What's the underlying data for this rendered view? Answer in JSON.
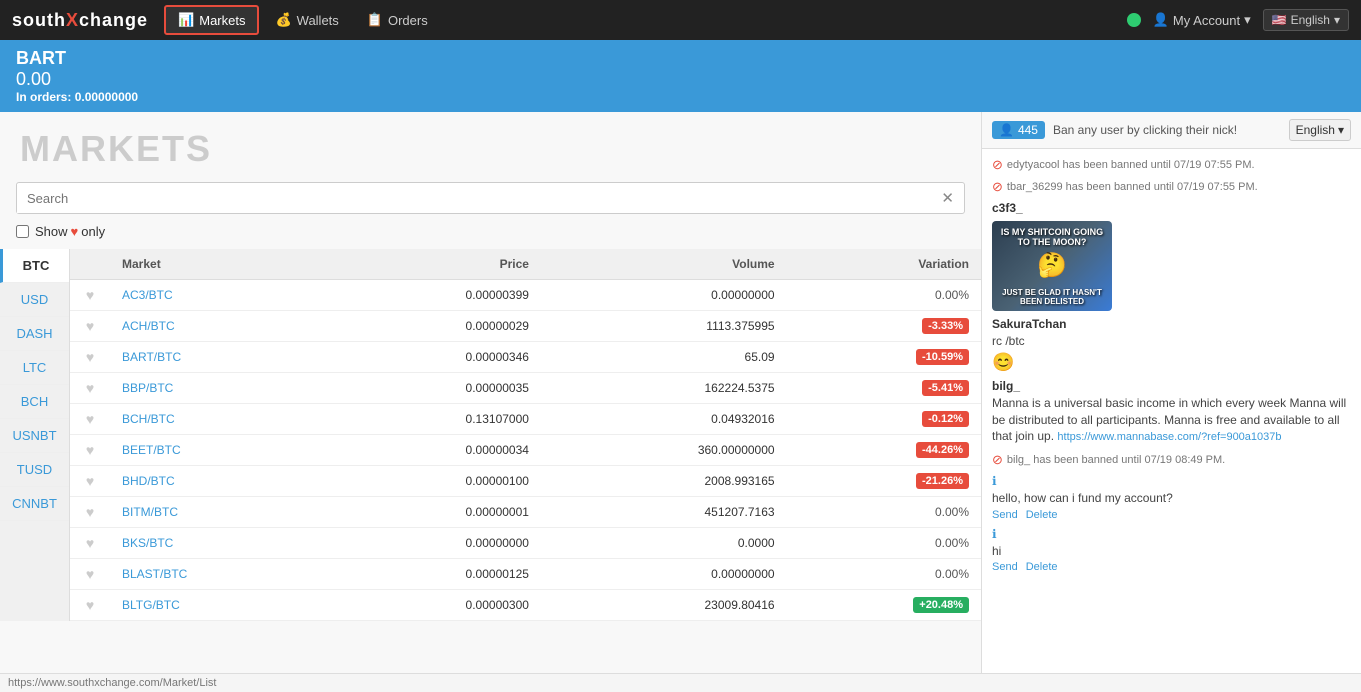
{
  "logo": {
    "text_south": "south",
    "text_x": "X",
    "text_change": "change"
  },
  "nav": {
    "items": [
      {
        "id": "markets",
        "label": "Markets",
        "icon": "chart-bar",
        "active": true
      },
      {
        "id": "wallets",
        "label": "Wallets",
        "icon": "wallet",
        "active": false
      },
      {
        "id": "orders",
        "label": "Orders",
        "icon": "list",
        "active": false
      }
    ],
    "my_account": "My Account",
    "language": "English",
    "language_icon": "🇺🇸"
  },
  "bart_header": {
    "coin": "BART",
    "price": "0.00",
    "in_orders_label": "In orders:",
    "in_orders_value": "0.00000000"
  },
  "markets_page": {
    "title": "MARKETS",
    "search_placeholder": "Search",
    "favorites_label": "Show",
    "favorites_only_label": "only",
    "currency_tabs": [
      {
        "id": "btc",
        "label": "BTC",
        "active": true
      },
      {
        "id": "usd",
        "label": "USD",
        "active": false
      },
      {
        "id": "dash",
        "label": "DASH",
        "active": false
      },
      {
        "id": "ltc",
        "label": "LTC",
        "active": false
      },
      {
        "id": "bch",
        "label": "BCH",
        "active": false
      },
      {
        "id": "usnbt",
        "label": "USNBT",
        "active": false
      },
      {
        "id": "tusd",
        "label": "TUSD",
        "active": false
      },
      {
        "id": "cnnbt",
        "label": "CNNBT",
        "active": false
      }
    ],
    "table_headers": [
      "",
      "Market",
      "Price",
      "Volume",
      "Variation"
    ],
    "rows": [
      {
        "market": "AC3/BTC",
        "href": "#",
        "price": "0.00000399",
        "price_bold": "0",
        "volume": "0.00000000",
        "variation": "0.00%",
        "variation_type": "neutral"
      },
      {
        "market": "ACH/BTC",
        "href": "#",
        "price": "0.00000029",
        "price_bold": "",
        "volume": "1113.375995",
        "variation": "-3.33%",
        "variation_type": "negative"
      },
      {
        "market": "BART/BTC",
        "href": "#",
        "price": "0.00000346",
        "price_bold": "",
        "volume": "65.09",
        "variation": "-10.59%",
        "variation_type": "negative"
      },
      {
        "market": "BBP/BTC",
        "href": "#",
        "price": "0.00000035",
        "price_bold": "",
        "volume": "162224.5375",
        "variation": "-5.41%",
        "variation_type": "negative"
      },
      {
        "market": "BCH/BTC",
        "href": "#",
        "price": "0.13107000",
        "price_bold": "",
        "volume": "0.04932016",
        "variation": "-0.12%",
        "variation_type": "negative"
      },
      {
        "market": "BEET/BTC",
        "href": "#",
        "price": "0.00000034",
        "price_bold": "",
        "volume": "360.00000000",
        "variation": "-44.26%",
        "variation_type": "negative"
      },
      {
        "market": "BHD/BTC",
        "href": "#",
        "price": "0.00000100",
        "price_bold": "",
        "volume": "2008.993165",
        "variation": "-21.26%",
        "variation_type": "negative"
      },
      {
        "market": "BITM/BTC",
        "href": "#",
        "price": "0.00000001",
        "price_bold": "",
        "volume": "451207.7163",
        "variation": "0.00%",
        "variation_type": "neutral"
      },
      {
        "market": "BKS/BTC",
        "href": "#",
        "price": "0.00000000",
        "price_bold": "",
        "volume": "0.0000",
        "variation": "0.00%",
        "variation_type": "neutral"
      },
      {
        "market": "BLAST/BTC",
        "href": "#",
        "price": "0.00000125",
        "price_bold": "",
        "volume": "0.00000000",
        "variation": "0.00%",
        "variation_type": "neutral"
      },
      {
        "market": "BLTG/BTC",
        "href": "#",
        "price": "0.00000300",
        "price_bold": "",
        "volume": "23009.80416",
        "variation": "+20.48%",
        "variation_type": "positive"
      }
    ]
  },
  "chat": {
    "online_icon": "👤",
    "online_count": "445",
    "ban_text": "Ban any user by clicking their nick!",
    "language": "English",
    "ban_notices": [
      "edytyacool has been banned until 07/19 07:55 PM.",
      "tbar_36299 has been banned until 07/19 07:55 PM."
    ],
    "messages": [
      {
        "id": "msg1",
        "username": "c3f3_",
        "type": "image",
        "meme_top": "IS MY SHITCOIN GOING TO THE MOON?",
        "meme_bottom": "JUST BE GLAD IT HASN'T BEEN DELISTED"
      },
      {
        "id": "msg2",
        "username": "SakuraTchan",
        "type": "text",
        "text": "rc /btc",
        "emoji": "😊"
      },
      {
        "id": "msg3",
        "username": "bilg_",
        "type": "text_with_link",
        "text": "Manna is a universal basic income in which every week Manna will be distributed to all participants. Manna is free and available to all that join up.",
        "link_text": "https://www.mannabase.com/?ref=900a1037b",
        "link_href": "#"
      },
      {
        "id": "ban3",
        "type": "ban",
        "text": "bilg_ has been banned until 07/19 08:49 PM."
      },
      {
        "id": "msg4",
        "type": "info",
        "username": "",
        "text": "hello, how can i fund my account?",
        "actions": [
          "Send",
          "Delete"
        ]
      },
      {
        "id": "msg5",
        "type": "info",
        "username": "",
        "text": "hi",
        "actions": [
          "Send",
          "Delete"
        ]
      }
    ]
  },
  "statusbar": {
    "url": "https://www.southxchange.com/Market/List"
  }
}
